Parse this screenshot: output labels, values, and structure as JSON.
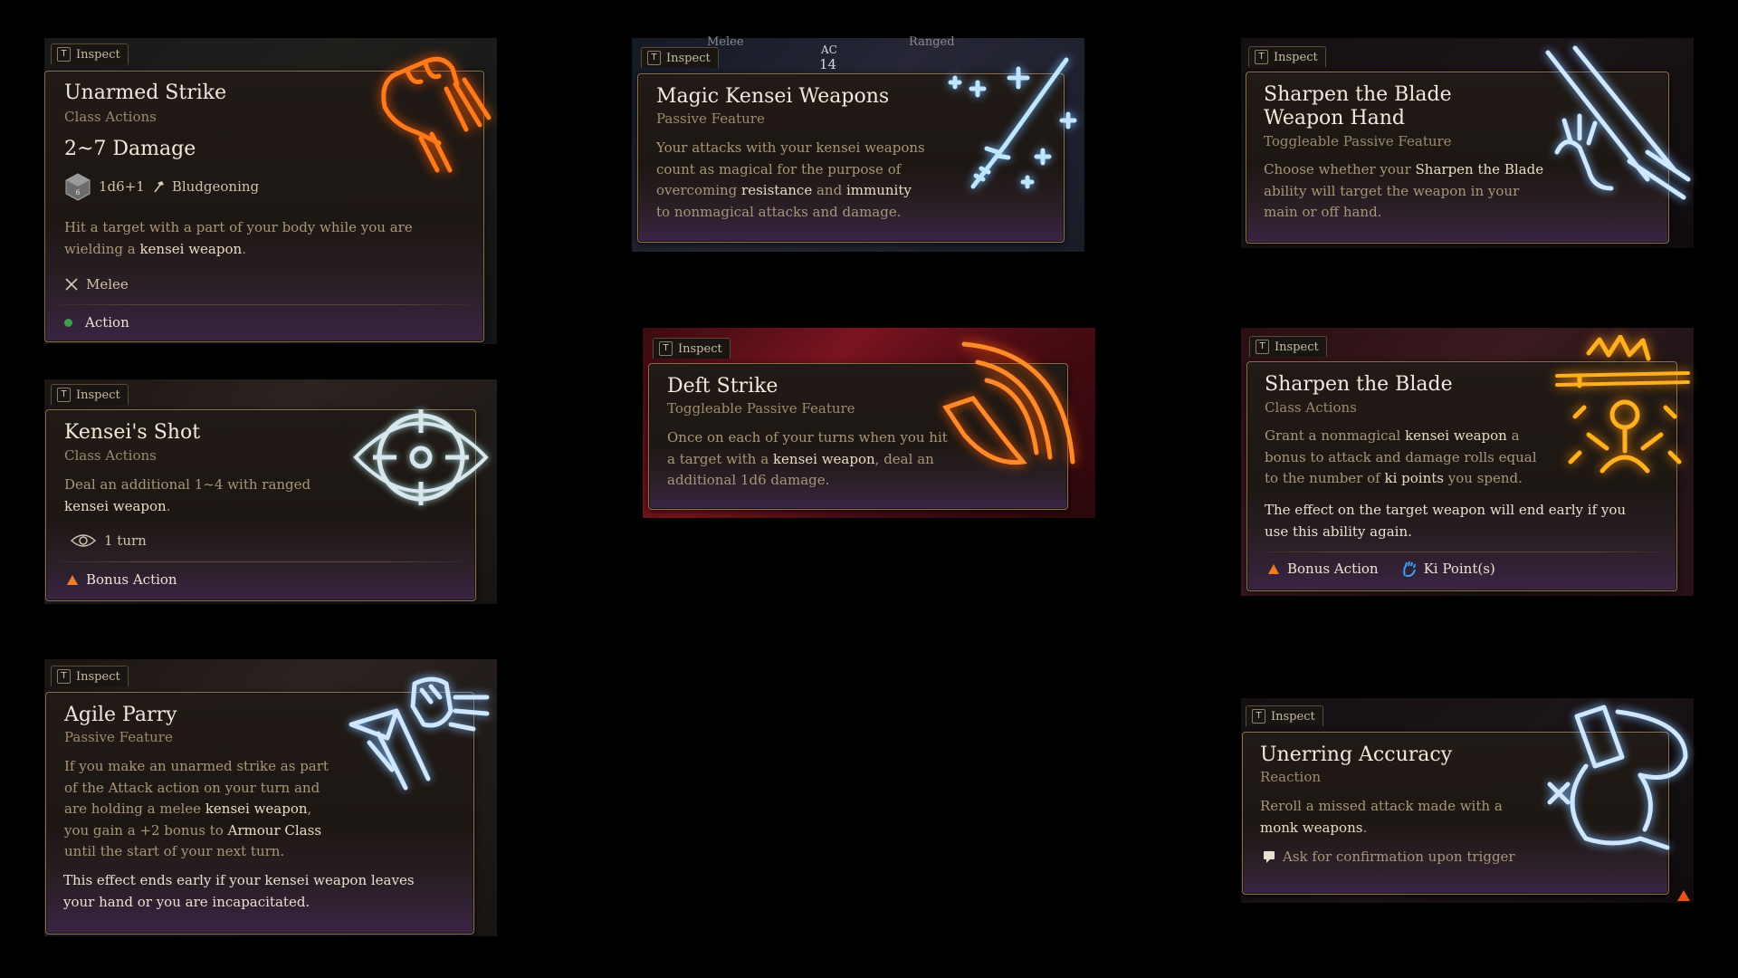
{
  "inspect_label": "Inspect",
  "inspect_key": "T",
  "cards": {
    "unarmed_strike": {
      "title": "Unarmed Strike",
      "subtitle": "Class Actions",
      "damage": "2~7 Damage",
      "dice": "1d6+1",
      "damage_type": "Bludgeoning",
      "desc_pre": "Hit a target with a part of your body while you are wielding a ",
      "desc_kw": "kensei weapon",
      "desc_post": ".",
      "range": "Melee",
      "cost": "Action"
    },
    "magic_kensei_weapons": {
      "title": "Magic Kensei Weapons",
      "subtitle": "Passive Feature",
      "d1": "Your attacks with your kensei weapons count as magical for the purpose of overcoming ",
      "kw1": "resistance",
      "d2": " and ",
      "kw2": "immunity",
      "d3": " to nonmagical attacks and damage.",
      "hud_melee": "Melee",
      "hud_ac": "AC",
      "hud_ac_val": "14",
      "hud_ranged": "Ranged"
    },
    "sharpen_blade_hand": {
      "title": "Sharpen the Blade Weapon Hand",
      "subtitle": "Toggleable Passive Feature",
      "d1": "Choose whether your ",
      "kw1": "Sharpen the Blade",
      "d2": " ability will target the weapon in your main or off hand."
    },
    "kenseis_shot": {
      "title": "Kensei's Shot",
      "subtitle": "Class Actions",
      "d1": "Deal an additional 1~4 with ranged ",
      "kw1": "kensei weapon",
      "d2": ".",
      "duration": "1 turn",
      "cost": "Bonus Action"
    },
    "deft_strike": {
      "title": "Deft Strike",
      "subtitle": "Toggleable Passive Feature",
      "d1": "Once on each of your turns when you hit a target with a ",
      "kw1": "kensei weapon",
      "d2": ", deal an additional 1d6 damage."
    },
    "sharpen_blade": {
      "title": "Sharpen the Blade",
      "subtitle": "Class Actions",
      "d1": "Grant a nonmagical ",
      "kw1": "kensei weapon",
      "d2": " a bonus to attack and damage rolls equal to the number of ",
      "kw2": "ki points",
      "d3": " you spend.",
      "extra": "The effect on the target weapon will end early if you use this ability again.",
      "cost": "Bonus Action",
      "resource": "Ki Point(s)"
    },
    "agile_parry": {
      "title": "Agile Parry",
      "subtitle": "Passive Feature",
      "d1": "If you make an unarmed strike as part of the Attack action on your turn and are holding a melee ",
      "kw1": "kensei weapon",
      "d2": ", you gain a +2 bonus to ",
      "kw2": "Armour Class",
      "d3": " until the start of your next turn.",
      "extra": "This effect ends early if your kensei weapon leaves your hand or you are incapacitated."
    },
    "unerring_accuracy": {
      "title": "Unerring Accuracy",
      "subtitle": "Reaction",
      "d1": "Reroll a missed attack made with a ",
      "kw1": "monk weapons",
      "d2": ".",
      "confirm": "Ask for confirmation upon trigger"
    }
  },
  "colors": {
    "fire": "#ff7a1a",
    "ice": "#bfe6ff",
    "keyword": "#e9dcc4",
    "desc": "#a89679",
    "action_green": "#3fa04a",
    "bonus_orange": "#f07a20"
  },
  "icons": [
    "fist-fire-icon",
    "katana-sparkle-icon",
    "katana-hand-icon",
    "target-eye-icon",
    "slash-fire-icon",
    "meditation-blade-icon",
    "parry-fist-icon",
    "monk-slash-icon",
    "dice-icon",
    "hammer-icon",
    "swords-icon",
    "eye-icon",
    "ki-hand-icon",
    "speech-icon"
  ]
}
